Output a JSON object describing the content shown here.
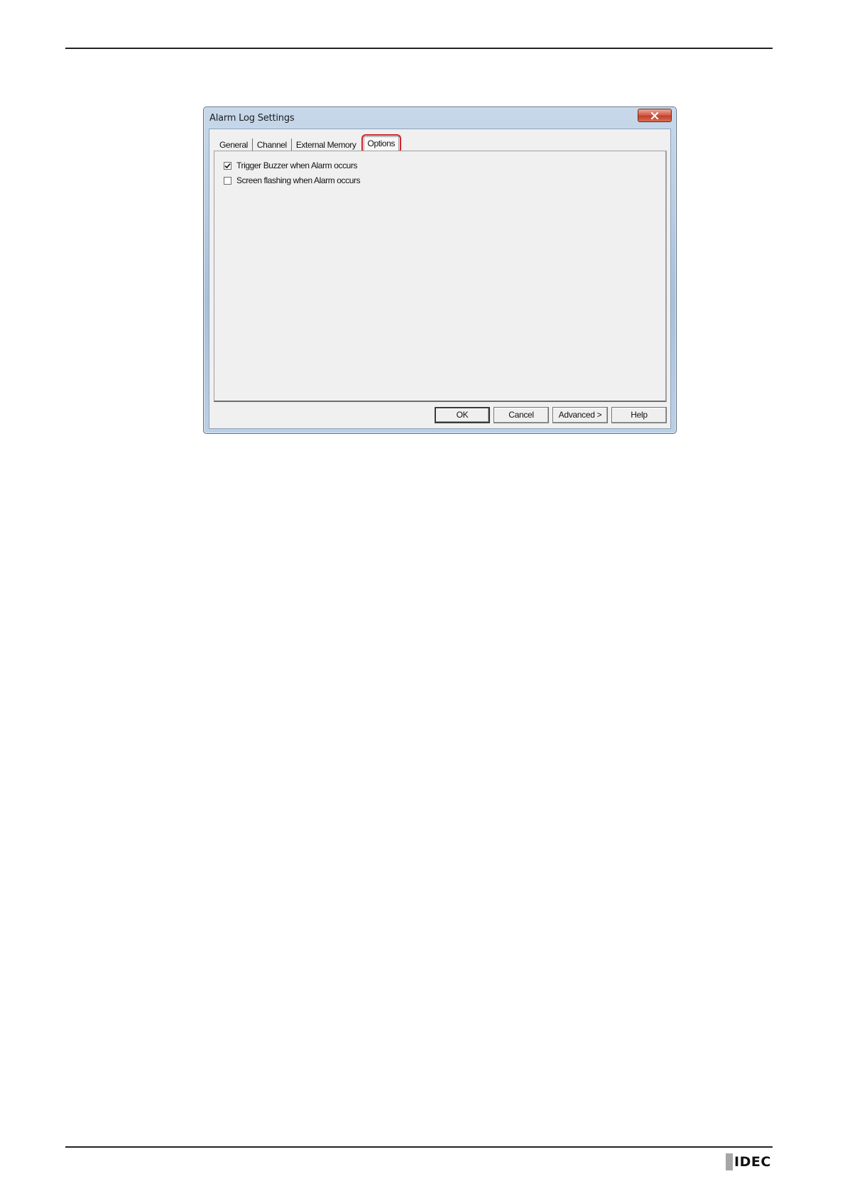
{
  "dialog": {
    "title": "Alarm Log Settings",
    "tabs": [
      {
        "label": "General"
      },
      {
        "label": "Channel"
      },
      {
        "label": "External Memory"
      },
      {
        "label": "Options",
        "active": true
      }
    ],
    "options": [
      {
        "label": "Trigger Buzzer when Alarm occurs",
        "checked": true
      },
      {
        "label": "Screen flashing when Alarm occurs",
        "checked": false
      }
    ],
    "buttons": {
      "ok": "OK",
      "cancel": "Cancel",
      "advanced": "Advanced >",
      "help": "Help"
    }
  },
  "footer": {
    "logo_text": "IDEC"
  },
  "colors": {
    "highlight": "#d0232f",
    "close_button": "#c2402a"
  }
}
